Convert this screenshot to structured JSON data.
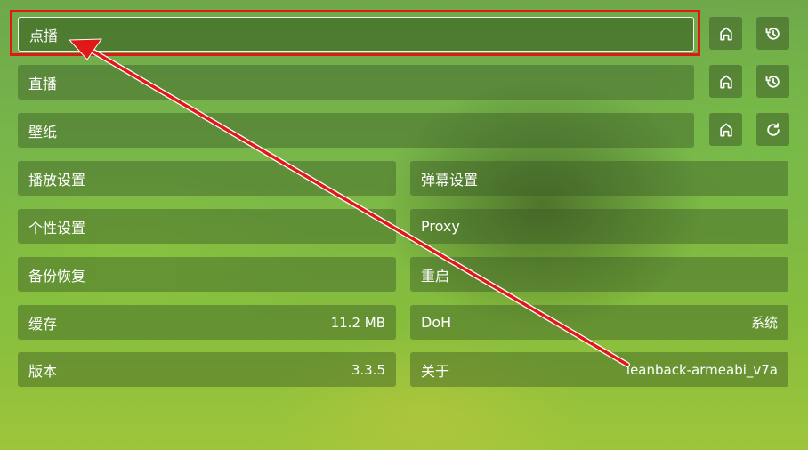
{
  "menu": {
    "vod": {
      "label": "点播"
    },
    "live": {
      "label": "直播"
    },
    "wallpaper": {
      "label": "壁纸"
    }
  },
  "settings": {
    "playback": {
      "label": "播放设置"
    },
    "danmaku": {
      "label": "弹幕设置"
    },
    "personal": {
      "label": "个性设置"
    },
    "proxy": {
      "label": "Proxy"
    },
    "backup": {
      "label": "备份恢复"
    },
    "restart": {
      "label": "重启"
    },
    "cache": {
      "label": "缓存",
      "value": "11.2 MB"
    },
    "doh": {
      "label": "DoH",
      "value": "系统"
    },
    "version": {
      "label": "版本",
      "value": "3.3.5"
    },
    "about": {
      "label": "关于",
      "value": "leanback-armeabi_v7a"
    }
  },
  "icons": {
    "home": "home-icon",
    "history": "history-icon",
    "refresh": "refresh-icon"
  },
  "annotation": {
    "color": "#e01818"
  }
}
